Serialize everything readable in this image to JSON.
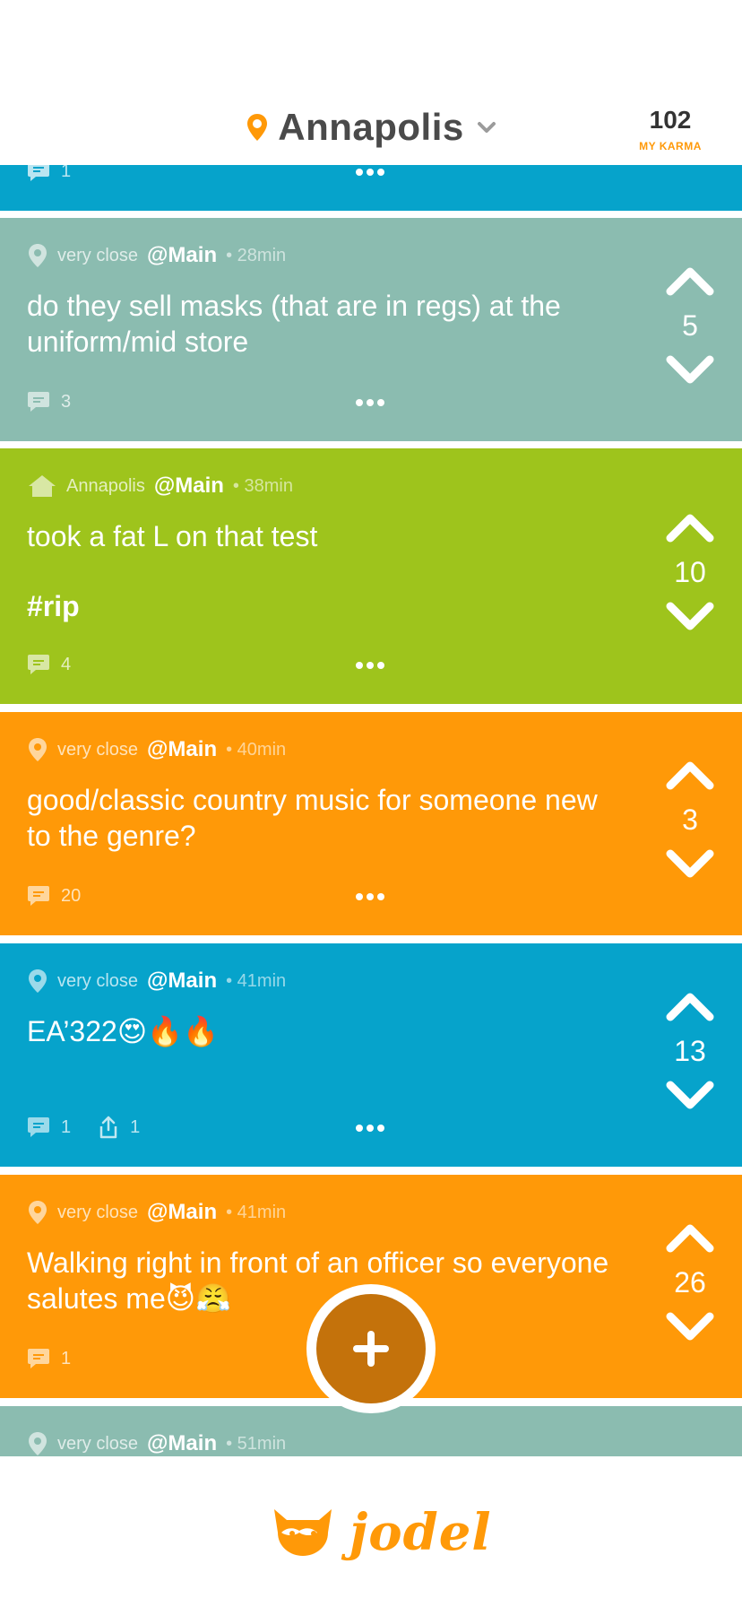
{
  "header": {
    "location": "Annapolis",
    "karma_value": "102",
    "karma_label": "MY KARMA"
  },
  "colors": {
    "teal": "#8bbcb0",
    "green": "#9ec41c",
    "orange": "#ff9908",
    "blue": "#06a3cb",
    "accent": "#ff9908"
  },
  "posts": [
    {
      "color": "blue",
      "comments": "1"
    },
    {
      "color": "teal",
      "location": "very close",
      "channel": "@Main",
      "time": "• 28min",
      "text": "do they sell masks (that are in regs) at the uniform/mid store",
      "votes": "5",
      "comments": "3"
    },
    {
      "color": "green",
      "location": "Annapolis",
      "channel": "@Main",
      "time": "• 38min",
      "text": "took a fat L on that test",
      "hashtag": "#rip",
      "votes": "10",
      "comments": "4"
    },
    {
      "color": "orange",
      "location": "very close",
      "channel": "@Main",
      "time": "• 40min",
      "text": "good/classic country music for someone new to the genre?",
      "votes": "3",
      "comments": "20"
    },
    {
      "color": "blue",
      "location": "very close",
      "channel": "@Main",
      "time": "• 41min",
      "text": "EA’322😍🔥🔥",
      "votes": "13",
      "comments": "1",
      "shares": "1"
    },
    {
      "color": "orange",
      "location": "very close",
      "channel": "@Main",
      "time": "• 41min",
      "text": "Walking right in front of an officer so everyone salutes me😈😤",
      "votes": "26",
      "comments": "1"
    },
    {
      "color": "teal",
      "location": "very close",
      "channel": "@Main",
      "time": "• 51min"
    }
  ],
  "brand": {
    "name": "jodel"
  }
}
